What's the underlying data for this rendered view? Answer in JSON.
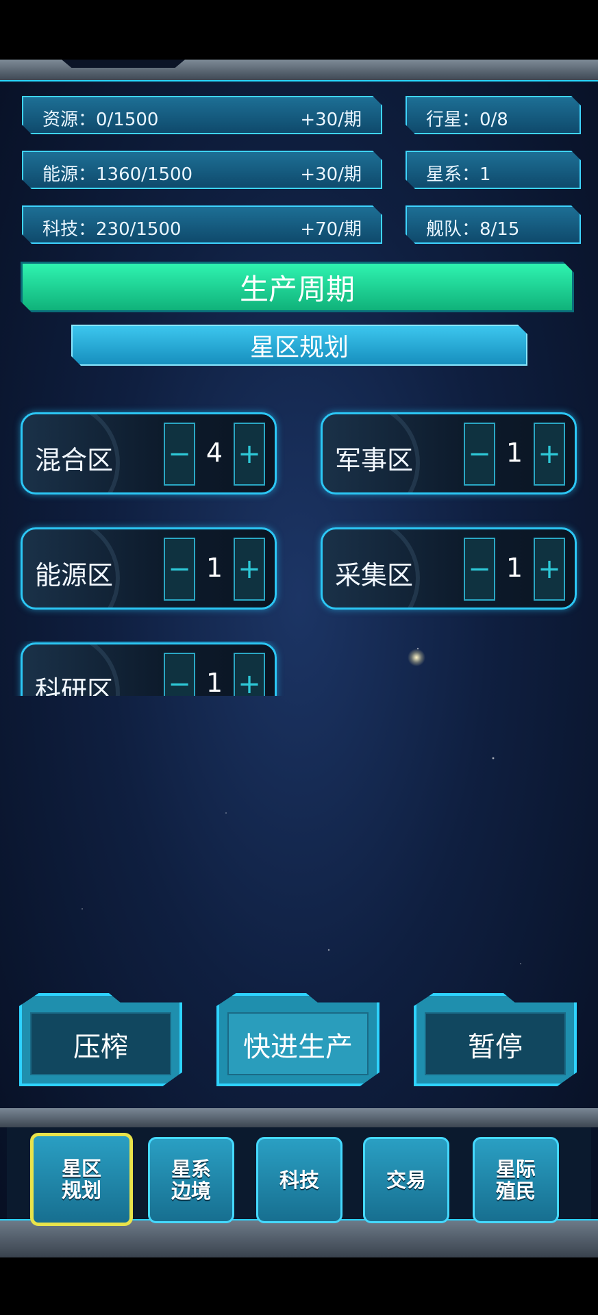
{
  "stats_left": [
    {
      "label": "资源：0/1500",
      "rate": "+30/期"
    },
    {
      "label": "能源：1360/1500",
      "rate": "+30/期"
    },
    {
      "label": "科技：230/1500",
      "rate": "+70/期"
    }
  ],
  "stats_right": [
    {
      "label": "行星：0/8"
    },
    {
      "label": "星系：1"
    },
    {
      "label": "舰队：8/15"
    }
  ],
  "production_cycle_label": "生产周期",
  "planning_label": "星区规划",
  "zones": [
    {
      "name": "混合区",
      "count": "4"
    },
    {
      "name": "军事区",
      "count": "1"
    },
    {
      "name": "能源区",
      "count": "1"
    },
    {
      "name": "采集区",
      "count": "1"
    },
    {
      "name": "科研区",
      "count": "1"
    }
  ],
  "controls": {
    "minus": "−",
    "plus": "+"
  },
  "actions": {
    "squeeze": "压榨",
    "fast_forward": "快进生产",
    "pause": "暂停"
  },
  "nav_tabs": [
    {
      "label": "星区\n规划",
      "active": true
    },
    {
      "label": "星系\n边境",
      "active": false
    },
    {
      "label": "科技",
      "active": false
    },
    {
      "label": "交易",
      "active": false
    },
    {
      "label": "星际\n殖民",
      "active": false
    }
  ],
  "colors": {
    "accent": "#2ed3ff",
    "green": "#1fd695",
    "active_tab": "#e9e34a"
  }
}
